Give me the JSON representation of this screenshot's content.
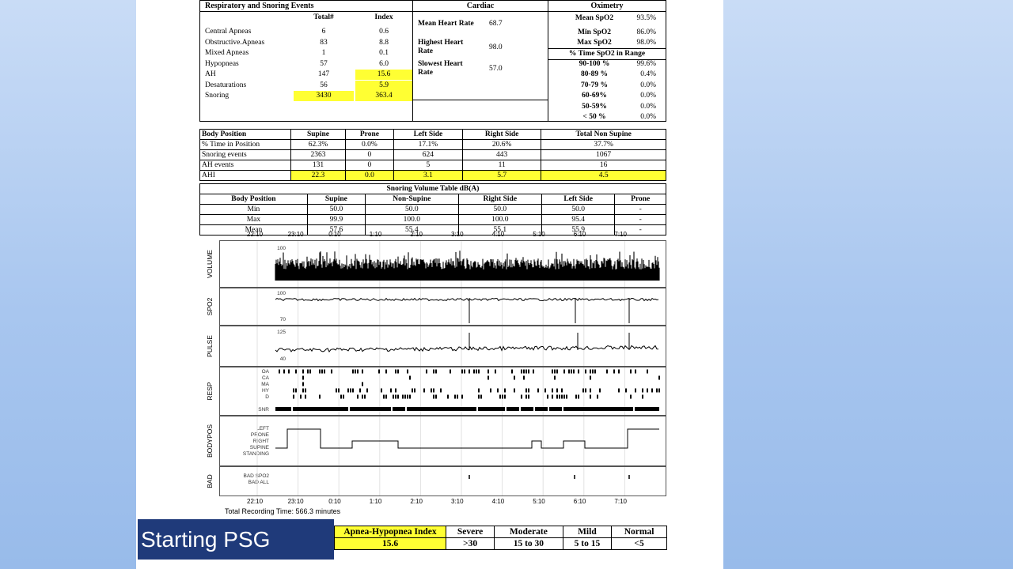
{
  "respiratory": {
    "title": "Respiratory and Snoring Events",
    "col_total": "Total#",
    "col_index": "Index",
    "rows": [
      {
        "label": "Central Apneas",
        "total": "6",
        "index": "0.6"
      },
      {
        "label": "Obstructive.Apneas",
        "total": "83",
        "index": "8.8"
      },
      {
        "label": "Mixed Apneas",
        "total": "1",
        "index": "0.1"
      },
      {
        "label": "Hypopneas",
        "total": "57",
        "index": "6.0"
      },
      {
        "label": "AH",
        "total": "147",
        "index": "15.6"
      },
      {
        "label": "Desaturations",
        "total": "56",
        "index": "5.9"
      },
      {
        "label": "Snoring",
        "total": "3430",
        "index": "363.4"
      }
    ]
  },
  "cardiac": {
    "title": "Cardiac",
    "mean_label": "Mean Heart Rate",
    "mean_value": "68.7",
    "high_label_1": "Highest Heart",
    "high_label_2": "Rate",
    "high_value": "98.0",
    "slow_label_1": "Slowest Heart",
    "slow_label_2": "Rate",
    "slow_value": "57.0"
  },
  "oximetry": {
    "title": "Oximetry",
    "mean_label": "Mean SpO2",
    "mean_value": "93.5%",
    "min_label": "Min SpO2",
    "min_value": "86.0%",
    "max_label": "Max SpO2",
    "max_value": "98.0%",
    "range_title": "% Time SpO2 in Range",
    "ranges": [
      {
        "label": "90-100 %",
        "value": "99.6%"
      },
      {
        "label": "80-89 %",
        "value": "0.4%"
      },
      {
        "label": "70-79 %",
        "value": "0.0%"
      },
      {
        "label": "60-69%",
        "value": "0.0%"
      },
      {
        "label": "50-59%",
        "value": "0.0%"
      },
      {
        "label": "< 50 %",
        "value": "0.0%"
      }
    ]
  },
  "body_position": {
    "headers": [
      "Body Position",
      "Supine",
      "Prone",
      "Left Side",
      "Right Side",
      "Total Non Supine"
    ],
    "rows": [
      [
        "% Time in Position",
        "62.3%",
        "0.0%",
        "17.1%",
        "20.6%",
        "37.7%"
      ],
      [
        "Snoring events",
        "2363",
        "0",
        "624",
        "443",
        "1067"
      ],
      [
        "AH events",
        "131",
        "0",
        "5",
        "11",
        "16"
      ],
      [
        "AHI",
        "22.3",
        "0.0",
        "3.1",
        "5.7",
        "4.5"
      ]
    ]
  },
  "snoring_volume": {
    "title": "Snoring Volume Table dB(A)",
    "headers": [
      "Body Position",
      "Supine",
      "Non-Supine",
      "Right Side",
      "Left Side",
      "Prone"
    ],
    "rows": [
      [
        "Min",
        "50.0",
        "50.0",
        "50.0",
        "50.0",
        "-"
      ],
      [
        "Max",
        "99.9",
        "100.0",
        "100.0",
        "95.4",
        "-"
      ],
      [
        "Mean",
        "57.6",
        "55.4",
        "55.1",
        "55.9",
        "-"
      ]
    ]
  },
  "chart": {
    "time_ticks": [
      "22:10",
      "23:10",
      "0:10",
      "1:10",
      "2:10",
      "3:10",
      "4:10",
      "5:10",
      "6:10",
      "7:10"
    ],
    "panels": {
      "volume": {
        "label": "VOLUME",
        "y_top": "100",
        "y_bottom": "50"
      },
      "spo2": {
        "label": "SPO2",
        "y_top": "100",
        "y_bottom": "70"
      },
      "pulse": {
        "label": "PULSE",
        "y_top": "125",
        "y_bottom": "40"
      },
      "resp": {
        "label": "RESP",
        "rows": [
          "OA",
          "CA",
          "MA",
          "HY",
          "D"
        ],
        "snr": "SNR"
      },
      "bodypos": {
        "label": "BODYPOS",
        "rows": [
          "LEFT",
          "PRONE",
          "RIGHT",
          "SUPINE",
          "STANDING"
        ]
      },
      "bad": {
        "label": "BAD",
        "rows": [
          "BAD SPO2",
          "BAD ALL"
        ]
      }
    },
    "total_recording": "Total Recording Time: 566.3 minutes"
  },
  "ahi_summary": {
    "index_label": "Apnea-Hypopnea Index",
    "index_value": "15.6",
    "categories": [
      {
        "label": "Severe",
        "range": ">30"
      },
      {
        "label": "Moderate",
        "range": "15 to 30"
      },
      {
        "label": "Mild",
        "range": "5 to 15"
      },
      {
        "label": "Normal",
        "range": "<5"
      }
    ]
  },
  "slide_label": "Starting PSG",
  "colors": {
    "highlight": "#ffff33",
    "label_bg": "#1f3a7a",
    "background": "#a8c6ef"
  }
}
